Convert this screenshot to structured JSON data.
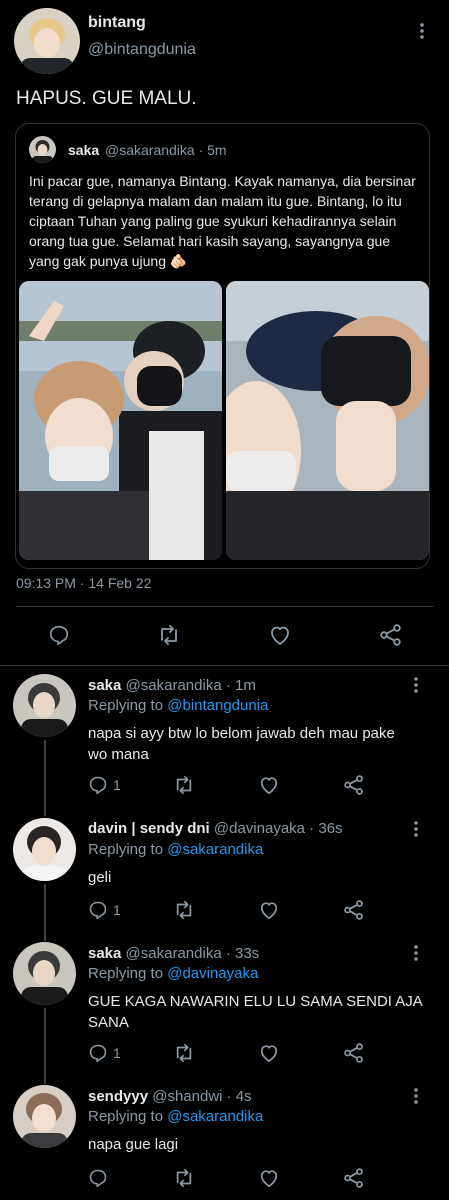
{
  "main_tweet": {
    "name": "bintang",
    "handle": "@bintangdunia",
    "text": "HAPUS. GUE MALU.",
    "timestamp": "09:13 PM · 14 Feb 22",
    "quoted": {
      "name": "saka",
      "handle_time": "@sakarandika · 5m",
      "text": "Ini pacar gue, namanya Bintang. Kayak namanya, dia bersinar terang di gelapnya malam dan malam itu gue. Bintang, lo itu ciptaan Tuhan yang paling gue syukuri kehadirannya selain orang tua gue. Selamat hari kasih sayang, sayangnya gue yang gak punya ujung 🫵🏻"
    }
  },
  "replies": [
    {
      "name": "saka",
      "meta": "@sakarandika · 1m",
      "replying_label": "Replying to",
      "replying_to": "@bintangdunia",
      "text": "napa si ayy btw lo belom jawab deh mau pake wo mana",
      "reply_count": "1"
    },
    {
      "name": "davin | sendy dni",
      "meta": "@davinayaka · 36s",
      "replying_label": "Replying to",
      "replying_to": "@sakarandika",
      "text": "geli",
      "reply_count": "1"
    },
    {
      "name": "saka",
      "meta": "@sakarandika · 33s",
      "replying_label": "Replying to",
      "replying_to": "@davinayaka",
      "text": "GUE KAGA NAWARIN ELU LU SAMA SENDI AJA SANA",
      "reply_count": "1"
    },
    {
      "name": "sendyyy",
      "meta": "@shandwi · 4s",
      "replying_label": "Replying to",
      "replying_to": "@sakarandika",
      "text": "napa gue lagi",
      "reply_count": ""
    }
  ],
  "icons": {
    "reply": "comment-icon",
    "retweet": "retweet-icon",
    "like": "heart-icon",
    "share": "share-icon",
    "more": "more-vertical-icon"
  },
  "colors": {
    "background": "#000000",
    "link": "#1d9bf0",
    "secondary": "#8b98a5",
    "divider": "#2f3336"
  }
}
